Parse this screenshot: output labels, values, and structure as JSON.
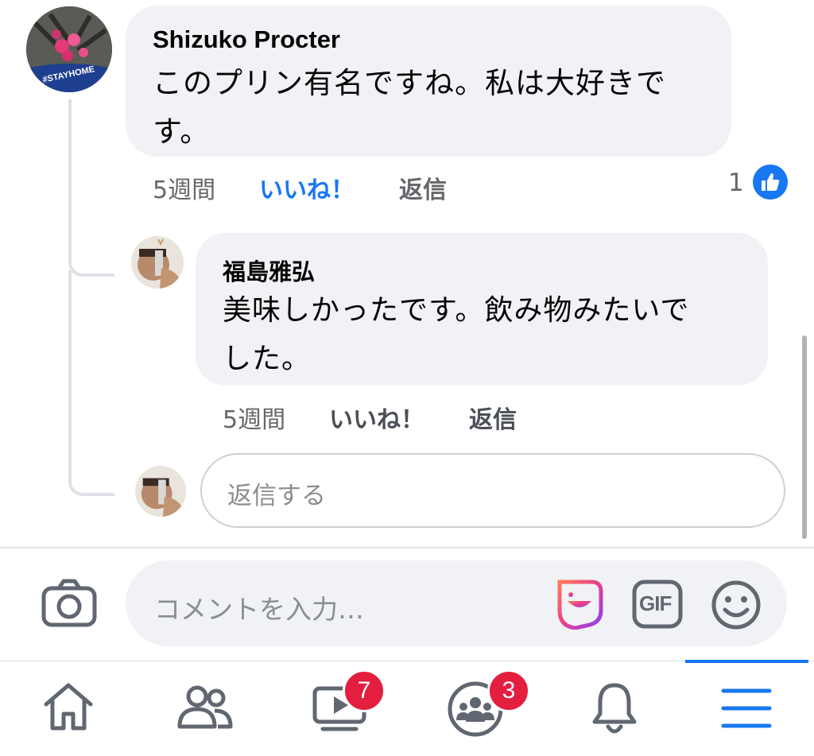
{
  "comment1": {
    "author": "Shizuko Procter",
    "text_line1": "このプリン有名ですね。私は大好きで",
    "text_line2": "す。",
    "time": "5週間",
    "like": "いいね！",
    "reply": "返信",
    "reactions_count": "1",
    "avatar_badge": "#STAYHOME"
  },
  "reply1": {
    "author": "福島雅弘",
    "text_line1": "美味しかったです。飲み物みたいで",
    "text_line2": "した。",
    "time": "5週間",
    "like": "いいね！",
    "reply": "返信"
  },
  "reply_input": {
    "placeholder": "返信する"
  },
  "composer": {
    "placeholder": "コメントを入力…",
    "gif_label": "GIF",
    "icons": [
      "camera-icon",
      "avatar-sticker-icon",
      "gif-icon",
      "emoji-icon"
    ]
  },
  "bottom_nav": {
    "items": [
      {
        "name": "home",
        "icon": "home-icon"
      },
      {
        "name": "friends",
        "icon": "friends-icon"
      },
      {
        "name": "watch",
        "icon": "video-icon",
        "badge": "7"
      },
      {
        "name": "groups",
        "icon": "groups-icon",
        "badge": "3"
      },
      {
        "name": "notifications",
        "icon": "bell-icon"
      },
      {
        "name": "menu",
        "icon": "hamburger-menu-icon",
        "active": true
      }
    ]
  },
  "colors": {
    "accent": "#1877f2",
    "badge": "#e41e3f",
    "bubble": "#f0f2f5",
    "secondary_text": "#65676b"
  }
}
